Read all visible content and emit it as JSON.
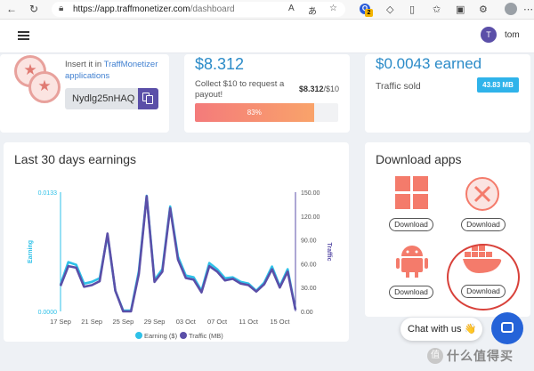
{
  "browser": {
    "url_host": "https://app.traffmonetizer.com",
    "url_path": "/dashboard",
    "ext_badge_count": "2"
  },
  "header": {
    "avatar_initial": "T",
    "username": "tom"
  },
  "referral": {
    "text_prefix": "Insert it in",
    "link_text": "TraffMonetizer",
    "text_suffix": "applications",
    "code": "Nydlg25nHAQ"
  },
  "balance": {
    "amount": "$8.312",
    "note": "Collect $10 to request a payout!",
    "current": "$8.312",
    "target": "/$10",
    "progress_label": "83%",
    "progress_fraction": 0.83
  },
  "traffic": {
    "earned": "$0.0043 earned",
    "label": "Traffic sold",
    "amount": "43.83 MB"
  },
  "earnings_section": {
    "title": "Last 30 days earnings"
  },
  "chart_data": {
    "type": "line",
    "ylabel_left": "Earning",
    "ylabel_right": "Traffic",
    "y_left_ticks": [
      "0.0000",
      "0.0133"
    ],
    "y_left_range": [
      0,
      0.0133
    ],
    "y_right_ticks": [
      "0.00",
      "30.00",
      "60.00",
      "90.00",
      "120.00",
      "150.00"
    ],
    "y_right_range": [
      0,
      150
    ],
    "x_ticks": [
      "17 Sep",
      "21 Sep",
      "25 Sep",
      "29 Sep",
      "03 Oct",
      "07 Oct",
      "11 Oct",
      "15 Oct"
    ],
    "x": [
      "17 Sep",
      "18 Sep",
      "19 Sep",
      "20 Sep",
      "21 Sep",
      "22 Sep",
      "23 Sep",
      "24 Sep",
      "25 Sep",
      "26 Sep",
      "27 Sep",
      "28 Sep",
      "29 Sep",
      "30 Sep",
      "01 Oct",
      "02 Oct",
      "03 Oct",
      "04 Oct",
      "05 Oct",
      "06 Oct",
      "07 Oct",
      "08 Oct",
      "09 Oct",
      "10 Oct",
      "11 Oct",
      "12 Oct",
      "13 Oct",
      "14 Oct",
      "15 Oct",
      "16 Oct",
      "17 Oct"
    ],
    "series": [
      {
        "name": "Earning ($)",
        "axis": "left",
        "color": "#2ec1e8",
        "values": [
          0.003,
          0.0055,
          0.0052,
          0.0031,
          0.0033,
          0.0037,
          0.0085,
          0.0023,
          0.0001,
          0.0001,
          0.0045,
          0.0129,
          0.0035,
          0.0047,
          0.0117,
          0.0061,
          0.004,
          0.0038,
          0.0023,
          0.0054,
          0.0047,
          0.0037,
          0.0038,
          0.0033,
          0.0031,
          0.0023,
          0.0032,
          0.005,
          0.0028,
          0.0047,
          0.0002
        ]
      },
      {
        "name": "Traffic (MB)",
        "axis": "right",
        "color": "#5b4fa8",
        "values": [
          32,
          57,
          55,
          31,
          33,
          38,
          98,
          26,
          0,
          0,
          47,
          145,
          37,
          50,
          130,
          65,
          42,
          40,
          24,
          57,
          50,
          39,
          41,
          35,
          33,
          25,
          34,
          53,
          30,
          50,
          2
        ]
      }
    ],
    "legend_position": "bottom"
  },
  "downloads": {
    "title": "Download apps",
    "button_label": "Download",
    "apps": [
      "windows-icon",
      "macos-icon",
      "android-icon",
      "docker-icon"
    ]
  },
  "chat": {
    "label": "Chat with us",
    "emoji": "👋"
  },
  "watermark": "什么值得买",
  "colors": {
    "accent_blue": "#2b8bc8",
    "purple": "#5b4fa8",
    "cyan": "#2ec1e8",
    "progress_start": "#f47b7b",
    "progress_end": "#f9a36a",
    "badge_cyan": "#2fb3ea",
    "highlight_ring": "#d8413a"
  }
}
